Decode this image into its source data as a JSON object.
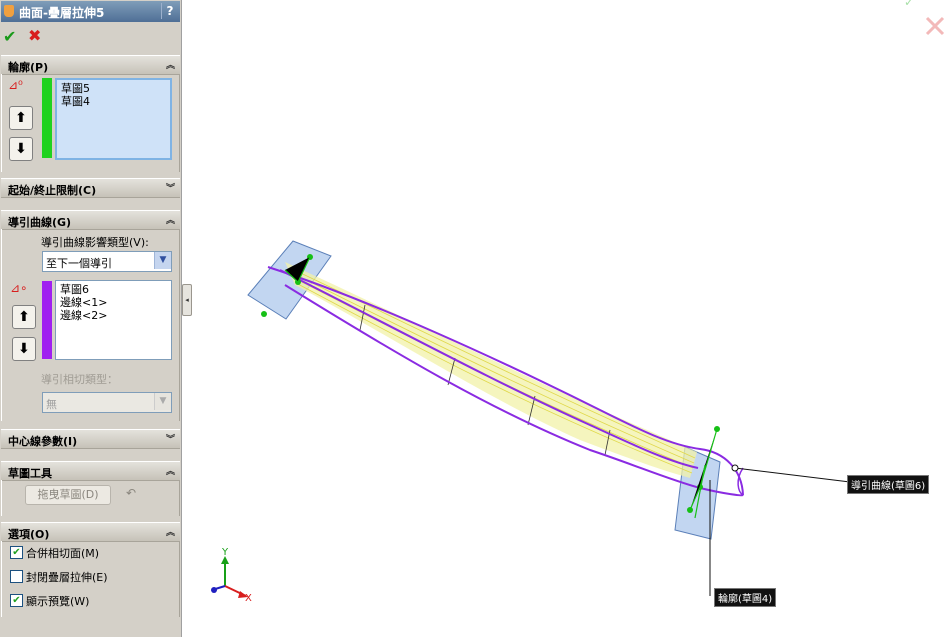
{
  "window": {
    "title": "曲面-疊層拉伸5",
    "help_label": "?"
  },
  "actions": {
    "ok_icon": "check-icon",
    "cancel_icon": "x-icon"
  },
  "profiles": {
    "header": "輪廓(P)",
    "items": [
      "草圖5",
      "草圖4"
    ],
    "color_bar": "#1fd21f"
  },
  "start_end": {
    "header": "起始/終止限制(C)"
  },
  "guides": {
    "header": "導引曲線(G)",
    "influence_label": "導引曲線影響類型(V):",
    "influence_value": "至下一個導引",
    "items": [
      "草圖6",
      "邊線<1>",
      "邊線<2>"
    ],
    "tangency_label": "導引相切類型：",
    "tangency_value": "無",
    "color_bar": "#a020f0"
  },
  "centerline": {
    "header": "中心線參數(I)"
  },
  "sketch_tools": {
    "header": "草圖工具",
    "drag_button": "拖曳草圖(D)",
    "undo_icon": "undo-icon"
  },
  "options": {
    "header": "選項(O)",
    "items": [
      {
        "label": "合併相切面(M)",
        "checked": true
      },
      {
        "label": "封閉疊層拉伸(E)",
        "checked": false
      },
      {
        "label": "顯示預覽(W)",
        "checked": true
      }
    ]
  },
  "viewport": {
    "callout_guide": "導引曲線(草圖6)",
    "callout_profile": "輪廓(草圖4)",
    "triad_y": "Y",
    "triad_x": "X"
  },
  "colors": {
    "accent_purple": "#8a2be2",
    "preview_yellow": "#e8e84a",
    "plane_blue": "#8fb4e6"
  }
}
